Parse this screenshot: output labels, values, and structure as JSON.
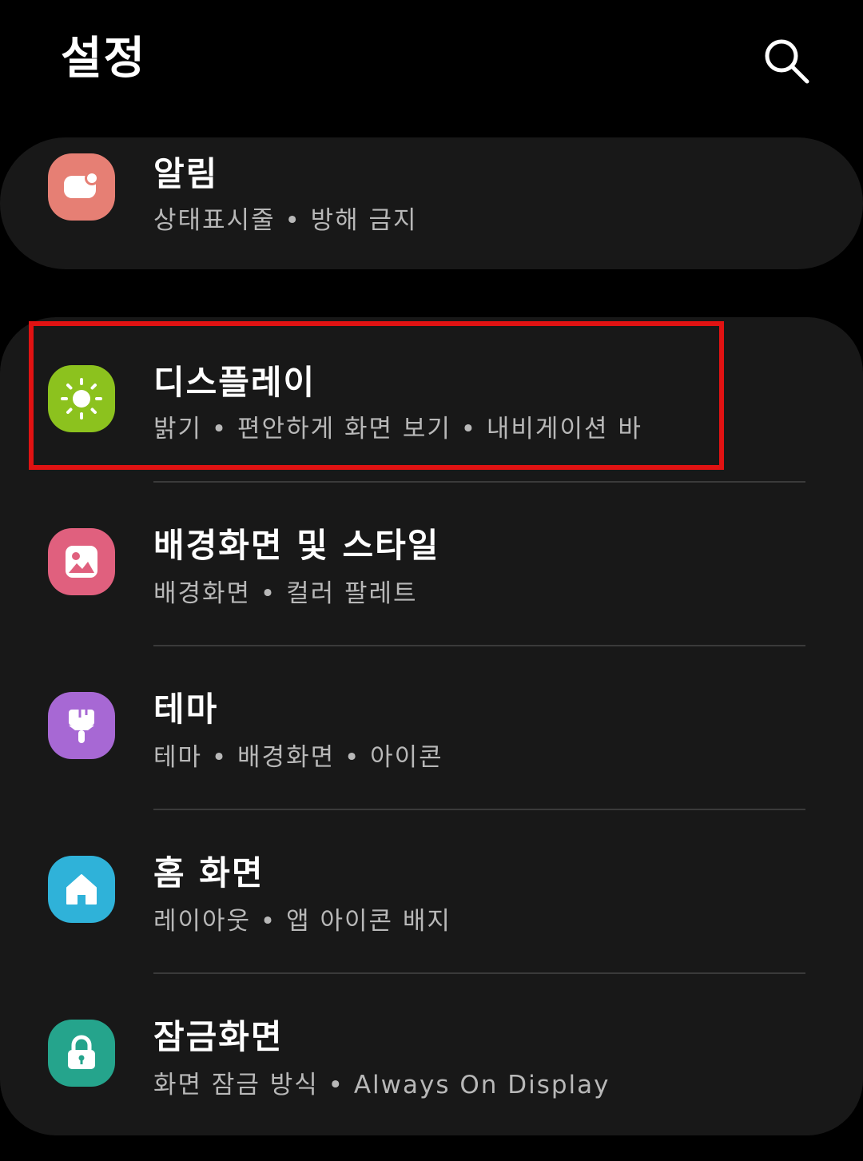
{
  "header": {
    "title": "설정",
    "search_icon": "search-icon"
  },
  "items": [
    {
      "title": "알림",
      "subtitle": "상태표시줄  •  방해 금지",
      "icon": "notification-icon",
      "color": "#E67F74"
    },
    {
      "title": "디스플레이",
      "subtitle": "밝기  •  편안하게 화면 보기  •  내비게이션 바",
      "icon": "sun-icon",
      "color": "#8CC21E"
    },
    {
      "title": "배경화면 및 스타일",
      "subtitle": "배경화면  •  컬러 팔레트",
      "icon": "picture-icon",
      "color": "#E0607E"
    },
    {
      "title": "테마",
      "subtitle": "테마  •  배경화면  •  아이콘",
      "icon": "paintbrush-icon",
      "color": "#A768D4"
    },
    {
      "title": "홈 화면",
      "subtitle": "레이아웃  •  앱 아이콘 배지",
      "icon": "home-icon",
      "color": "#2FB2D9"
    },
    {
      "title": "잠금화면",
      "subtitle": "화면 잠금 방식  •  Always On Display",
      "icon": "lock-icon",
      "color": "#25A48C"
    }
  ],
  "colors": {
    "background": "#000000",
    "card": "#181818",
    "highlight": "#E01212"
  }
}
